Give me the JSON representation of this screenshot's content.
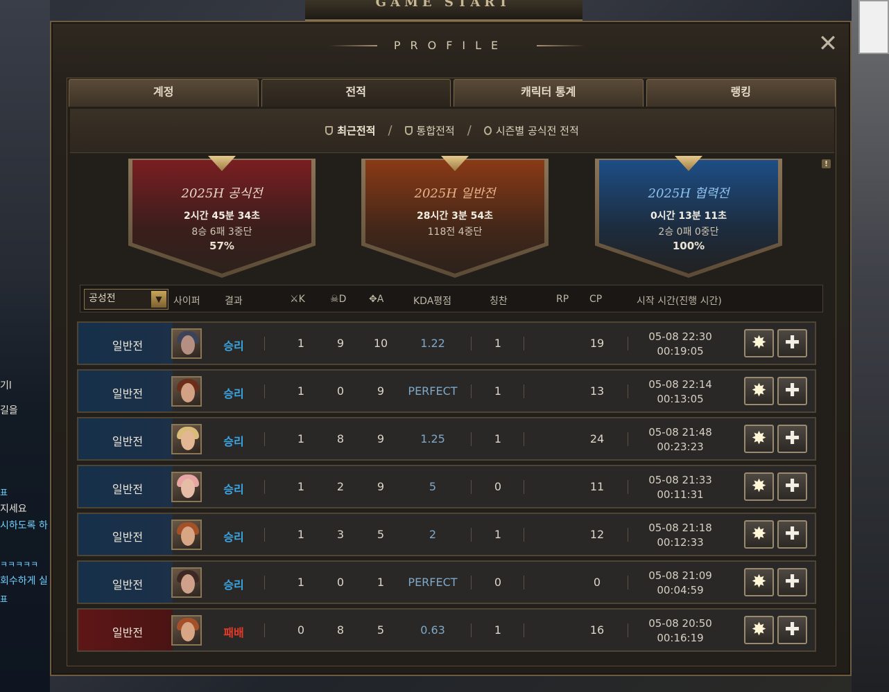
{
  "window": {
    "title": "PROFILE",
    "top_banner": "GAME START"
  },
  "tabs": [
    {
      "label": "계정",
      "active": false
    },
    {
      "label": "전적",
      "active": true
    },
    {
      "label": "캐릭터 통계",
      "active": false
    },
    {
      "label": "랭킹",
      "active": false
    }
  ],
  "subnav": [
    {
      "label": "최근전적",
      "icon": "shield-icon",
      "active": true
    },
    {
      "label": "통합전적",
      "icon": "shield-icon",
      "active": false
    },
    {
      "label": "시즌별 공식전 전적",
      "icon": "medal-icon",
      "active": false
    }
  ],
  "summary": [
    {
      "title": "2025H 공식전",
      "time": "2시간 45분 34초",
      "record": "8승 6패 3중단",
      "rate": "57%",
      "color": "#7a1e22",
      "title_color": "#e9d7c8"
    },
    {
      "title": "2025H 일반전",
      "time": "28시간 3분 54초",
      "record": "118전 4중단",
      "rate": "",
      "color": "#8a3a16",
      "title_color": "#e8b48a"
    },
    {
      "title": "2025H 협력전",
      "time": "0시간 13분 11초",
      "record": "2승 0패 0중단",
      "rate": "100%",
      "color": "#1d4e86",
      "title_color": "#8fc3ef"
    }
  ],
  "alert_icon": "!",
  "table": {
    "filter": "공성전",
    "headers": {
      "cypher": "사이퍼",
      "result": "결과",
      "k": "K",
      "d": "D",
      "a": "A",
      "kda": "KDA평점",
      "praise": "칭찬",
      "rp": "RP",
      "cp": "CP",
      "start": "시작 시간(진행 시간)"
    },
    "rows": [
      {
        "type": "일반전",
        "result": "승리",
        "k": "1",
        "d": "9",
        "a": "10",
        "kda": "1.22",
        "praise": "1",
        "cp": "19",
        "date": "05-08 22:30",
        "duration": "00:19:05",
        "loss": false
      },
      {
        "type": "일반전",
        "result": "승리",
        "k": "1",
        "d": "0",
        "a": "9",
        "kda": "PERFECT",
        "praise": "1",
        "cp": "13",
        "date": "05-08 22:14",
        "duration": "00:13:05",
        "loss": false
      },
      {
        "type": "일반전",
        "result": "승리",
        "k": "1",
        "d": "8",
        "a": "9",
        "kda": "1.25",
        "praise": "1",
        "cp": "24",
        "date": "05-08 21:48",
        "duration": "00:23:23",
        "loss": false
      },
      {
        "type": "일반전",
        "result": "승리",
        "k": "1",
        "d": "2",
        "a": "9",
        "kda": "5",
        "praise": "0",
        "cp": "11",
        "date": "05-08 21:33",
        "duration": "00:11:31",
        "loss": false
      },
      {
        "type": "일반전",
        "result": "승리",
        "k": "1",
        "d": "3",
        "a": "5",
        "kda": "2",
        "praise": "1",
        "cp": "12",
        "date": "05-08 21:18",
        "duration": "00:12:33",
        "loss": false
      },
      {
        "type": "일반전",
        "result": "승리",
        "k": "1",
        "d": "0",
        "a": "1",
        "kda": "PERFECT",
        "praise": "0",
        "cp": "0",
        "date": "05-08 21:09",
        "duration": "00:04:59",
        "loss": false
      },
      {
        "type": "일반전",
        "result": "패배",
        "k": "0",
        "d": "8",
        "a": "5",
        "kda": "0.63",
        "praise": "1",
        "cp": "16",
        "date": "05-08 20:50",
        "duration": "00:16:19",
        "loss": true
      }
    ]
  },
  "background_chat": [
    "기l",
    "길을",
    "표",
    "지세요",
    "시하도록 하",
    "ㅋㅋㅋㅋㅋ",
    "회수하게 실",
    "표"
  ]
}
